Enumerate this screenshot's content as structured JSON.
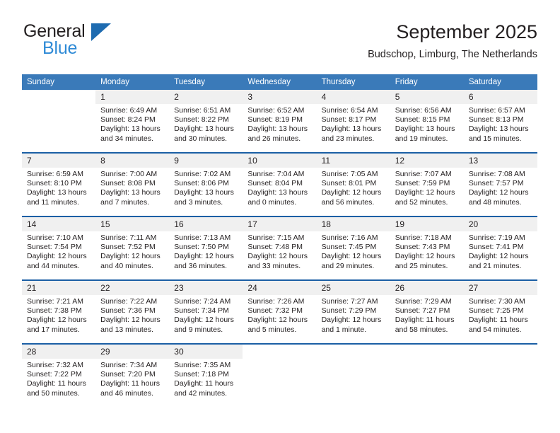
{
  "brand": {
    "name_part1": "General",
    "name_part2": "Blue",
    "triangle_icon": "triangle-icon"
  },
  "header": {
    "title": "September 2025",
    "subtitle": "Budschop, Limburg, The Netherlands"
  },
  "colors": {
    "header_blue": "#3a7ab9",
    "separator_blue": "#1b5fa5",
    "daynum_band": "#f0f0f0",
    "brand_blue": "#2e8ad6",
    "text": "#231f20"
  },
  "weekday_headers": [
    "Sunday",
    "Monday",
    "Tuesday",
    "Wednesday",
    "Thursday",
    "Friday",
    "Saturday"
  ],
  "weeks": [
    {
      "days": [
        {
          "num": "",
          "sunrise": "",
          "sunset": "",
          "daylight1": "",
          "daylight2": "",
          "empty": true
        },
        {
          "num": "1",
          "sunrise": "Sunrise: 6:49 AM",
          "sunset": "Sunset: 8:24 PM",
          "daylight1": "Daylight: 13 hours",
          "daylight2": "and 34 minutes."
        },
        {
          "num": "2",
          "sunrise": "Sunrise: 6:51 AM",
          "sunset": "Sunset: 8:22 PM",
          "daylight1": "Daylight: 13 hours",
          "daylight2": "and 30 minutes."
        },
        {
          "num": "3",
          "sunrise": "Sunrise: 6:52 AM",
          "sunset": "Sunset: 8:19 PM",
          "daylight1": "Daylight: 13 hours",
          "daylight2": "and 26 minutes."
        },
        {
          "num": "4",
          "sunrise": "Sunrise: 6:54 AM",
          "sunset": "Sunset: 8:17 PM",
          "daylight1": "Daylight: 13 hours",
          "daylight2": "and 23 minutes."
        },
        {
          "num": "5",
          "sunrise": "Sunrise: 6:56 AM",
          "sunset": "Sunset: 8:15 PM",
          "daylight1": "Daylight: 13 hours",
          "daylight2": "and 19 minutes."
        },
        {
          "num": "6",
          "sunrise": "Sunrise: 6:57 AM",
          "sunset": "Sunset: 8:13 PM",
          "daylight1": "Daylight: 13 hours",
          "daylight2": "and 15 minutes."
        }
      ]
    },
    {
      "days": [
        {
          "num": "7",
          "sunrise": "Sunrise: 6:59 AM",
          "sunset": "Sunset: 8:10 PM",
          "daylight1": "Daylight: 13 hours",
          "daylight2": "and 11 minutes."
        },
        {
          "num": "8",
          "sunrise": "Sunrise: 7:00 AM",
          "sunset": "Sunset: 8:08 PM",
          "daylight1": "Daylight: 13 hours",
          "daylight2": "and 7 minutes."
        },
        {
          "num": "9",
          "sunrise": "Sunrise: 7:02 AM",
          "sunset": "Sunset: 8:06 PM",
          "daylight1": "Daylight: 13 hours",
          "daylight2": "and 3 minutes."
        },
        {
          "num": "10",
          "sunrise": "Sunrise: 7:04 AM",
          "sunset": "Sunset: 8:04 PM",
          "daylight1": "Daylight: 13 hours",
          "daylight2": "and 0 minutes."
        },
        {
          "num": "11",
          "sunrise": "Sunrise: 7:05 AM",
          "sunset": "Sunset: 8:01 PM",
          "daylight1": "Daylight: 12 hours",
          "daylight2": "and 56 minutes."
        },
        {
          "num": "12",
          "sunrise": "Sunrise: 7:07 AM",
          "sunset": "Sunset: 7:59 PM",
          "daylight1": "Daylight: 12 hours",
          "daylight2": "and 52 minutes."
        },
        {
          "num": "13",
          "sunrise": "Sunrise: 7:08 AM",
          "sunset": "Sunset: 7:57 PM",
          "daylight1": "Daylight: 12 hours",
          "daylight2": "and 48 minutes."
        }
      ]
    },
    {
      "days": [
        {
          "num": "14",
          "sunrise": "Sunrise: 7:10 AM",
          "sunset": "Sunset: 7:54 PM",
          "daylight1": "Daylight: 12 hours",
          "daylight2": "and 44 minutes."
        },
        {
          "num": "15",
          "sunrise": "Sunrise: 7:11 AM",
          "sunset": "Sunset: 7:52 PM",
          "daylight1": "Daylight: 12 hours",
          "daylight2": "and 40 minutes."
        },
        {
          "num": "16",
          "sunrise": "Sunrise: 7:13 AM",
          "sunset": "Sunset: 7:50 PM",
          "daylight1": "Daylight: 12 hours",
          "daylight2": "and 36 minutes."
        },
        {
          "num": "17",
          "sunrise": "Sunrise: 7:15 AM",
          "sunset": "Sunset: 7:48 PM",
          "daylight1": "Daylight: 12 hours",
          "daylight2": "and 33 minutes."
        },
        {
          "num": "18",
          "sunrise": "Sunrise: 7:16 AM",
          "sunset": "Sunset: 7:45 PM",
          "daylight1": "Daylight: 12 hours",
          "daylight2": "and 29 minutes."
        },
        {
          "num": "19",
          "sunrise": "Sunrise: 7:18 AM",
          "sunset": "Sunset: 7:43 PM",
          "daylight1": "Daylight: 12 hours",
          "daylight2": "and 25 minutes."
        },
        {
          "num": "20",
          "sunrise": "Sunrise: 7:19 AM",
          "sunset": "Sunset: 7:41 PM",
          "daylight1": "Daylight: 12 hours",
          "daylight2": "and 21 minutes."
        }
      ]
    },
    {
      "days": [
        {
          "num": "21",
          "sunrise": "Sunrise: 7:21 AM",
          "sunset": "Sunset: 7:38 PM",
          "daylight1": "Daylight: 12 hours",
          "daylight2": "and 17 minutes."
        },
        {
          "num": "22",
          "sunrise": "Sunrise: 7:22 AM",
          "sunset": "Sunset: 7:36 PM",
          "daylight1": "Daylight: 12 hours",
          "daylight2": "and 13 minutes."
        },
        {
          "num": "23",
          "sunrise": "Sunrise: 7:24 AM",
          "sunset": "Sunset: 7:34 PM",
          "daylight1": "Daylight: 12 hours",
          "daylight2": "and 9 minutes."
        },
        {
          "num": "24",
          "sunrise": "Sunrise: 7:26 AM",
          "sunset": "Sunset: 7:32 PM",
          "daylight1": "Daylight: 12 hours",
          "daylight2": "and 5 minutes."
        },
        {
          "num": "25",
          "sunrise": "Sunrise: 7:27 AM",
          "sunset": "Sunset: 7:29 PM",
          "daylight1": "Daylight: 12 hours",
          "daylight2": "and 1 minute."
        },
        {
          "num": "26",
          "sunrise": "Sunrise: 7:29 AM",
          "sunset": "Sunset: 7:27 PM",
          "daylight1": "Daylight: 11 hours",
          "daylight2": "and 58 minutes."
        },
        {
          "num": "27",
          "sunrise": "Sunrise: 7:30 AM",
          "sunset": "Sunset: 7:25 PM",
          "daylight1": "Daylight: 11 hours",
          "daylight2": "and 54 minutes."
        }
      ]
    },
    {
      "days": [
        {
          "num": "28",
          "sunrise": "Sunrise: 7:32 AM",
          "sunset": "Sunset: 7:22 PM",
          "daylight1": "Daylight: 11 hours",
          "daylight2": "and 50 minutes."
        },
        {
          "num": "29",
          "sunrise": "Sunrise: 7:34 AM",
          "sunset": "Sunset: 7:20 PM",
          "daylight1": "Daylight: 11 hours",
          "daylight2": "and 46 minutes."
        },
        {
          "num": "30",
          "sunrise": "Sunrise: 7:35 AM",
          "sunset": "Sunset: 7:18 PM",
          "daylight1": "Daylight: 11 hours",
          "daylight2": "and 42 minutes."
        },
        {
          "num": "",
          "sunrise": "",
          "sunset": "",
          "daylight1": "",
          "daylight2": "",
          "empty": true
        },
        {
          "num": "",
          "sunrise": "",
          "sunset": "",
          "daylight1": "",
          "daylight2": "",
          "empty": true
        },
        {
          "num": "",
          "sunrise": "",
          "sunset": "",
          "daylight1": "",
          "daylight2": "",
          "empty": true
        },
        {
          "num": "",
          "sunrise": "",
          "sunset": "",
          "daylight1": "",
          "daylight2": "",
          "empty": true
        }
      ]
    }
  ]
}
